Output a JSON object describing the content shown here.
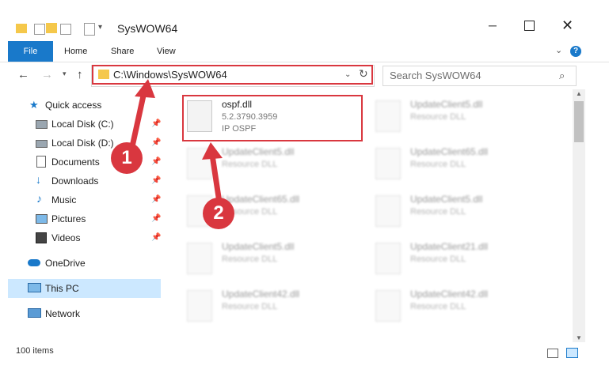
{
  "window": {
    "title": "SysWOW64"
  },
  "ribbon": {
    "file": "File",
    "tabs": [
      "Home",
      "Share",
      "View"
    ]
  },
  "address": {
    "path": "C:\\Windows\\SysWOW64"
  },
  "search": {
    "placeholder": "Search SysWOW64"
  },
  "sidebar": {
    "items": [
      {
        "label": "Quick access"
      },
      {
        "label": "Local Disk (C:)"
      },
      {
        "label": "Local Disk (D:)"
      },
      {
        "label": "Documents"
      },
      {
        "label": "Downloads"
      },
      {
        "label": "Music"
      },
      {
        "label": "Pictures"
      },
      {
        "label": "Videos"
      },
      {
        "label": "OneDrive"
      },
      {
        "label": "This PC"
      },
      {
        "label": "Network"
      }
    ]
  },
  "files": [
    {
      "name": "ospf.dll",
      "line2": "5.2.3790.3959",
      "line3": "IP OSPF"
    },
    {
      "name": "UpdateClient5.dll",
      "line2": "Resource DLL"
    },
    {
      "name": "UpdateClient5.dll",
      "line2": "Resource DLL"
    },
    {
      "name": "UpdateClient65.dll",
      "line2": "Resource DLL"
    },
    {
      "name": "UpdateClient65.dll",
      "line2": "Resource DLL"
    },
    {
      "name": "UpdateClient5.dll",
      "line2": "Resource DLL"
    },
    {
      "name": "UpdateClient5.dll",
      "line2": "Resource DLL"
    },
    {
      "name": "UpdateClient21.dll",
      "line2": "Resource DLL"
    },
    {
      "name": "UpdateClient42.dll",
      "line2": "Resource DLL"
    },
    {
      "name": "UpdateClient42.dll",
      "line2": "Resource DLL"
    }
  ],
  "annotations": {
    "step1": "1",
    "step2": "2"
  },
  "status": {
    "count": "100 items"
  },
  "colors": {
    "accent": "#1979ca",
    "highlight": "#d9373f",
    "selected": "#cce8ff"
  }
}
